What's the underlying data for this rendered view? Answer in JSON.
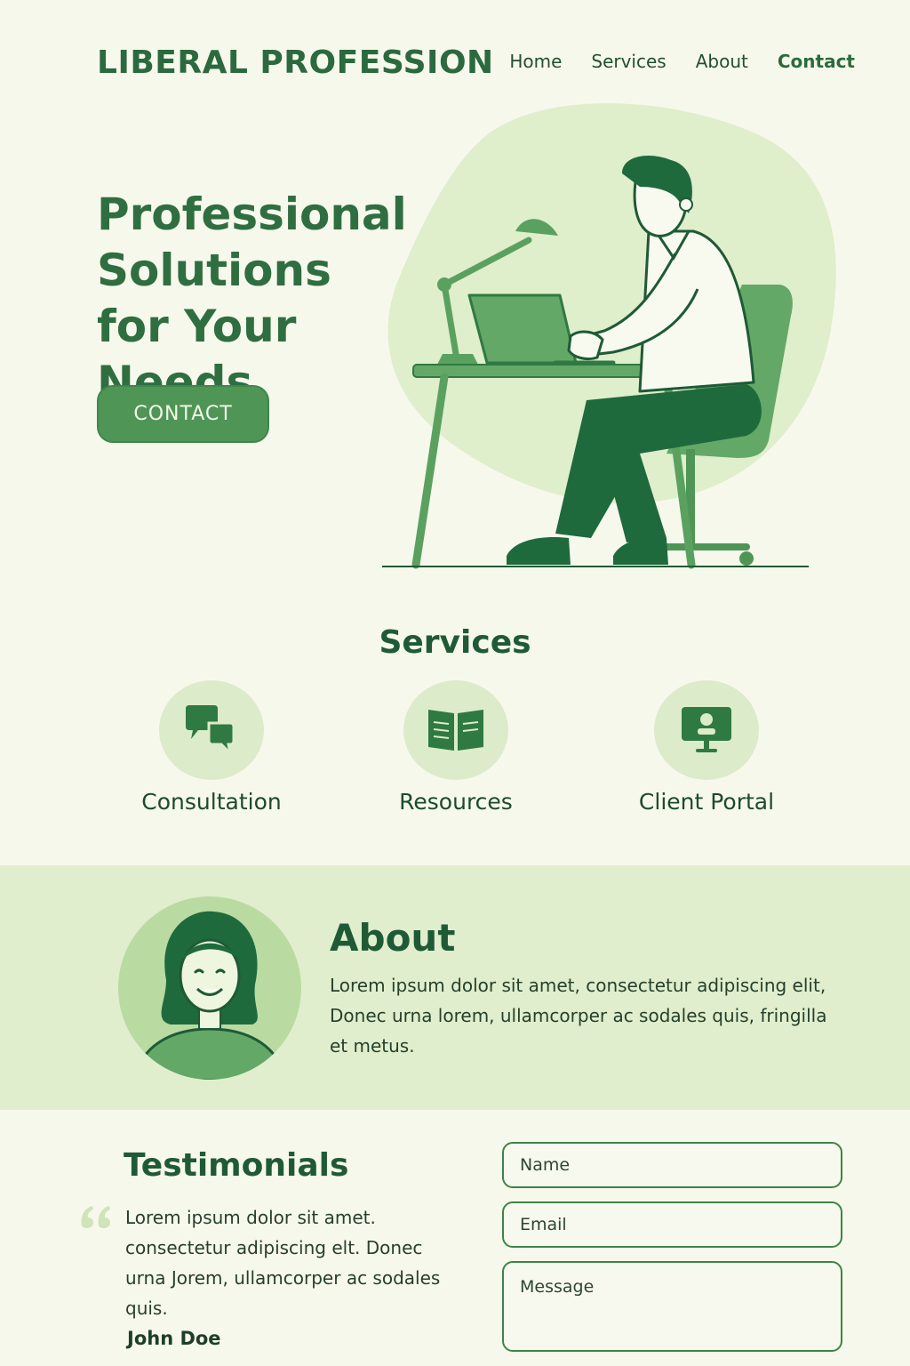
{
  "header": {
    "brand": "LIBERAL PROFESSION",
    "nav": [
      {
        "label": "Home"
      },
      {
        "label": "Services"
      },
      {
        "label": "About"
      },
      {
        "label": "Contact"
      }
    ],
    "active_nav": "Contact"
  },
  "hero": {
    "title": "Professional Solutions for Your Needs",
    "button_label": "CONTACT",
    "illustration": "man-working-at-laptop-illustration"
  },
  "services": {
    "title": "Services",
    "items": [
      {
        "label": "Consultation",
        "icon": "chat-bubbles-icon"
      },
      {
        "label": "Resources",
        "icon": "open-book-icon"
      },
      {
        "label": "Client Portal",
        "icon": "monitor-user-icon"
      }
    ]
  },
  "about": {
    "title": "About",
    "text": "Lorem ipsum dolor sit amet, consectetur adipiscing elit, Donec urna lorem, ullamcorper ac sodales quis, fringilla et metus."
  },
  "testimonials": {
    "title": "Testimonials",
    "quote": "Lorem ipsum dolor sit amet. consectetur adipiscing elt. Donec urna Jorem, ullamcorper ac sodales quis.",
    "author": "John Doe"
  },
  "contact_form": {
    "name_placeholder": "Name",
    "email_placeholder": "Email",
    "message_placeholder": "Message"
  },
  "colors": {
    "background": "#f7f8ec",
    "primary": "#4f9656",
    "dark_green": "#1f5a36",
    "light_green": "#e0eecd"
  }
}
